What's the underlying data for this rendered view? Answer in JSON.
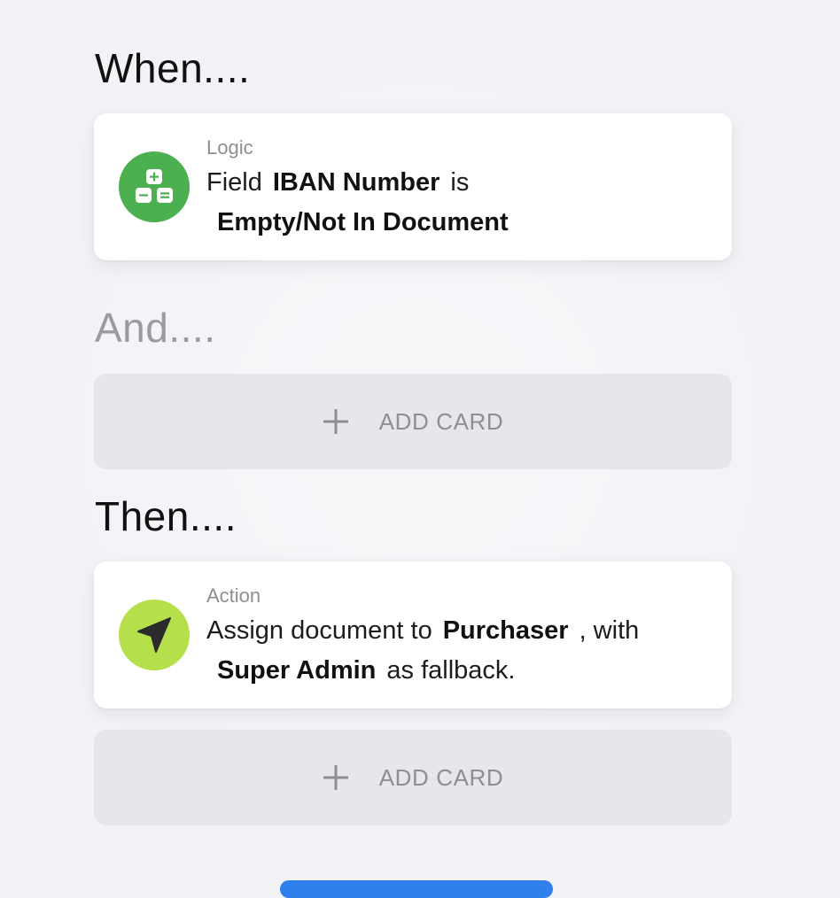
{
  "headings": {
    "when": "When....",
    "and": "And....",
    "then": "Then...."
  },
  "logic_card": {
    "category": "Logic",
    "prefix": "Field",
    "field_name": "IBAN Number",
    "connector": "is",
    "condition": "Empty/Not In Document",
    "icon": "calculator-icon",
    "icon_color": "#4caf50"
  },
  "action_card": {
    "category": "Action",
    "prefix": "Assign document to",
    "assignee": "Purchaser",
    "connector": ", with",
    "fallback": "Super Admin",
    "suffix": "as fallback.",
    "icon": "navigation-arrow-icon",
    "icon_color": "#b5e04c"
  },
  "add_card": {
    "label": "ADD CARD",
    "icon": "plus-icon"
  },
  "colors": {
    "background": "#f2f2f7",
    "card_background": "#ffffff",
    "add_card_background": "#e6e6eb",
    "primary_button": "#2f80ed"
  }
}
